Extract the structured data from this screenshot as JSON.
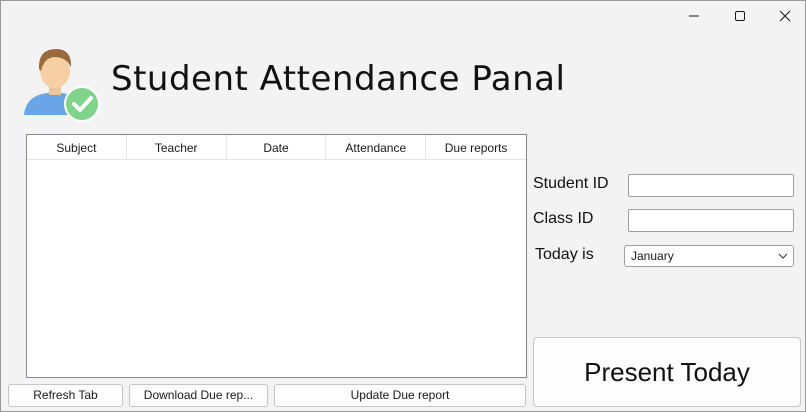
{
  "window": {
    "minimize_icon": "minimize-icon",
    "maximize_icon": "maximize-icon",
    "close_icon": "close-icon"
  },
  "header": {
    "title": "Student Attendance Panal",
    "avatar_icon": "student-check-avatar-icon"
  },
  "table": {
    "columns": [
      "Subject",
      "Teacher",
      "Date",
      "Attendance",
      "Due reports"
    ],
    "rows": []
  },
  "buttons": {
    "refresh": "Refresh Tab",
    "download": "Download Due rep...",
    "update": "Update Due report",
    "present": "Present Today"
  },
  "form": {
    "student_id_label": "Student ID",
    "student_id_value": "",
    "class_id_label": "Class ID",
    "class_id_value": "",
    "today_label": "Today is",
    "month_selected": "January"
  },
  "colors": {
    "window_bg": "#f3f3f3",
    "check_badge": "#7fd38b",
    "avatar_shirt": "#6aa5e8",
    "avatar_hair": "#9b6a3c"
  }
}
